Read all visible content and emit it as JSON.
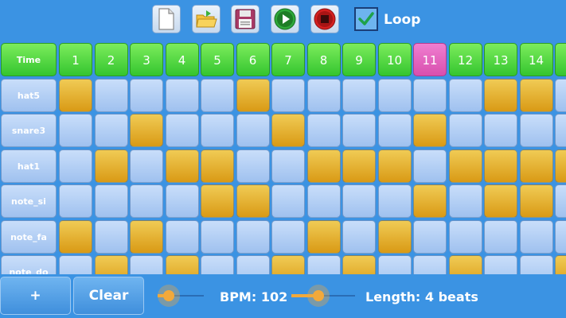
{
  "toolbar": {
    "buttons": [
      {
        "name": "new-file-button",
        "icon": "new-file-icon"
      },
      {
        "name": "open-folder-button",
        "icon": "open-folder-icon"
      },
      {
        "name": "save-button",
        "icon": "save-icon"
      },
      {
        "name": "play-button",
        "icon": "play-icon"
      },
      {
        "name": "stop-button",
        "icon": "stop-icon"
      }
    ],
    "loop": {
      "label": "Loop",
      "checked": true
    }
  },
  "grid": {
    "corner_label": "Time",
    "columns": [
      "1",
      "2",
      "3",
      "4",
      "5",
      "6",
      "7",
      "8",
      "9",
      "10",
      "11",
      "12",
      "13",
      "14"
    ],
    "current_column": "11",
    "rows": [
      {
        "label": "hat5",
        "cells": [
          1,
          0,
          0,
          0,
          0,
          1,
          0,
          0,
          0,
          0,
          0,
          0,
          1,
          1,
          0
        ]
      },
      {
        "label": "snare3",
        "cells": [
          0,
          0,
          1,
          0,
          0,
          0,
          1,
          0,
          0,
          0,
          1,
          0,
          0,
          0,
          0
        ]
      },
      {
        "label": "hat1",
        "cells": [
          0,
          1,
          0,
          1,
          1,
          0,
          0,
          1,
          1,
          1,
          0,
          1,
          1,
          1,
          1
        ]
      },
      {
        "label": "note_si",
        "cells": [
          0,
          0,
          0,
          0,
          1,
          1,
          0,
          0,
          0,
          0,
          1,
          0,
          1,
          1,
          0
        ]
      },
      {
        "label": "note_fa",
        "cells": [
          1,
          0,
          1,
          0,
          0,
          0,
          0,
          1,
          0,
          1,
          0,
          0,
          0,
          0,
          0
        ]
      },
      {
        "label": "note_do",
        "cells": [
          0,
          1,
          0,
          1,
          0,
          0,
          1,
          0,
          1,
          0,
          0,
          1,
          0,
          0,
          1
        ]
      }
    ]
  },
  "bottom": {
    "add_label": "+",
    "clear_label": "Clear",
    "bpm_label": "BPM: 102",
    "length_label": "Length: 4 beats"
  },
  "colors": {
    "background": "#3b93e3",
    "active_cell": "#e6b02f",
    "inactive_cell": "#b3cff4",
    "header": "#4fd63a",
    "current_header": "#e466c0",
    "slider_accent": "#f2a93b"
  }
}
